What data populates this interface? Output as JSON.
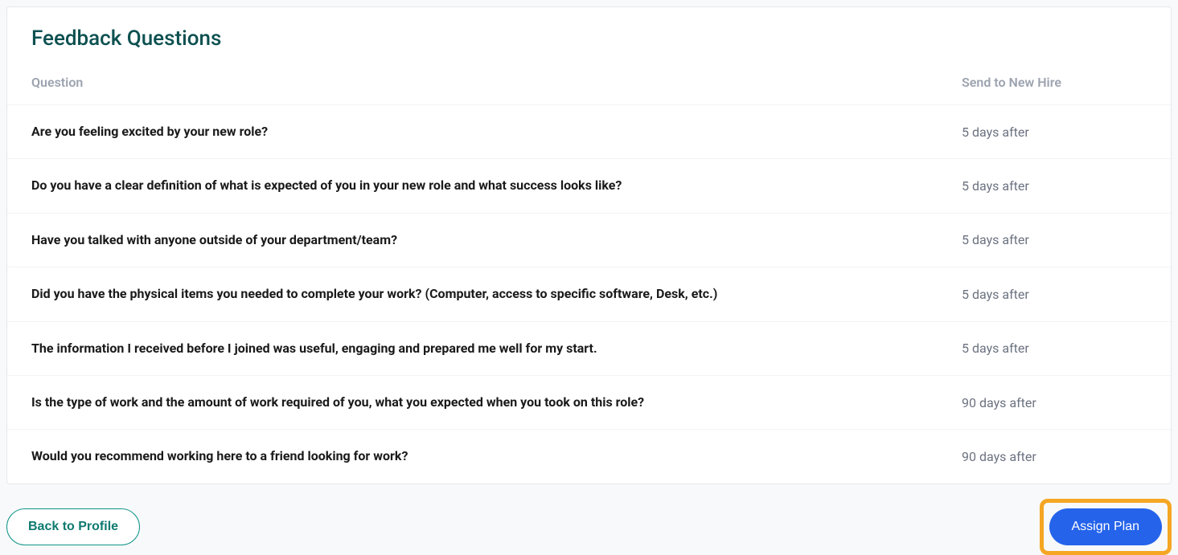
{
  "title": "Feedback Questions",
  "columns": {
    "question": "Question",
    "send": "Send to New Hire"
  },
  "questions": [
    {
      "text": "Are you feeling excited by your new role?",
      "timing": "5 days after"
    },
    {
      "text": "Do you have a clear definition of what is expected of you in your new role and what success looks like?",
      "timing": "5 days after"
    },
    {
      "text": "Have you talked with anyone outside of your department/team?",
      "timing": "5 days after"
    },
    {
      "text": "Did you have the physical items you needed to complete your work? (Computer, access to specific software, Desk, etc.)",
      "timing": "5 days after"
    },
    {
      "text": "The information I received before I joined was useful, engaging and prepared me well for my start.",
      "timing": "5 days after"
    },
    {
      "text": "Is the type of work and the amount of work required of you, what you expected when you took on this role?",
      "timing": "90 days after"
    },
    {
      "text": "Would you recommend working here to a friend looking for work?",
      "timing": "90 days after"
    }
  ],
  "buttons": {
    "back": "Back to Profile",
    "assign": "Assign Plan"
  }
}
